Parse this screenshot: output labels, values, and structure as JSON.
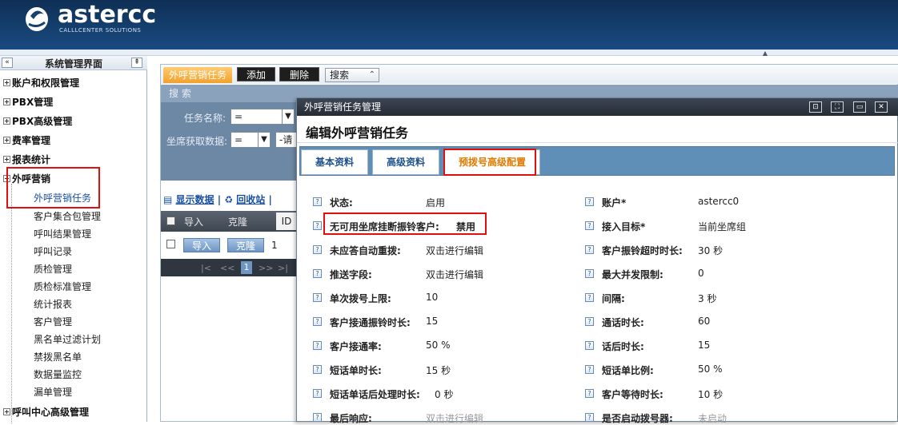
{
  "header": {
    "logo_text": "astercc",
    "logo_subtitle": "CALLLCENTER SOLUTIONS",
    "brand_color": "#15406f"
  },
  "sidebar": {
    "title": "系统管理界面",
    "collapse_icon": "«",
    "pin_icon": "⇞",
    "groups": [
      {
        "label": "账户和权限管理"
      },
      {
        "label": "PBX管理"
      },
      {
        "label": "PBX高级管理"
      },
      {
        "label": "费率管理"
      },
      {
        "label": "报表统计"
      },
      {
        "label": "外呼营销"
      }
    ],
    "outbound_items": [
      "外呼营销任务",
      "客户集合包管理",
      "呼叫结果管理",
      "呼叫记录",
      "质检管理",
      "质检标准管理",
      "统计报表",
      "客户管理",
      "黑名单过滤计划",
      "禁拨黑名单",
      "数据量监控",
      "漏单管理"
    ],
    "last_group": "呼叫中心高级管理"
  },
  "main": {
    "tab": "外呼营销任务",
    "add_button": "添加",
    "delete_button": "删除",
    "search_toggle": "搜索",
    "search_toggle_icon": "⌃",
    "search_header": "搜 索",
    "task_name_label": "任务名称:",
    "task_name_op": "=",
    "agent_data_label": "坐席获取数据:",
    "agent_data_op": "=",
    "agent_data_value": "-请",
    "link_show": "显示数据",
    "link_sep": "|",
    "link_recycle": "回收站",
    "grid_cols": [
      "导入",
      "克隆",
      "ID"
    ],
    "row_import": "导入",
    "row_clone": "克隆",
    "row_id": "1",
    "pager": [
      "|<",
      "<<",
      "1",
      ">>",
      ">|"
    ]
  },
  "dialog": {
    "title": "外呼营销任务管理",
    "heading": "编辑外呼营销任务",
    "tabs": [
      "基本资料",
      "高级资料",
      "预拨号高级配置"
    ],
    "icons": [
      "restore-icon",
      "maximize-icon",
      "minimize-icon",
      "close-icon"
    ],
    "left_fields": [
      {
        "label": "状态:",
        "value": "启用"
      },
      {
        "label": "无可用坐席挂断振铃客户:",
        "value": "禁用"
      },
      {
        "label": "未应答自动重拨:",
        "value": "双击进行编辑"
      },
      {
        "label": "推送字段:",
        "value": "双击进行编辑"
      },
      {
        "label": "单次拨号上限:",
        "value": "10"
      },
      {
        "label": "客户接通振铃时长:",
        "value": "15"
      },
      {
        "label": "客户接通率:",
        "value": "50 %"
      },
      {
        "label": "短话单时长:",
        "value": "15 秒"
      },
      {
        "label": "短话单话后处理时长:",
        "value": "0 秒"
      },
      {
        "label": "最后响应:",
        "value": "双击进行编辑"
      }
    ],
    "right_fields": [
      {
        "label": "账户*",
        "value": "astercc0"
      },
      {
        "label": "接入目标*",
        "value": "当前坐席组"
      },
      {
        "label": "客户振铃超时时长:",
        "value": "30 秒"
      },
      {
        "label": "最大并发限制:",
        "value": "0"
      },
      {
        "label": "间隔:",
        "value": "3 秒"
      },
      {
        "label": "通话时长:",
        "value": "60"
      },
      {
        "label": "话后时长:",
        "value": "15"
      },
      {
        "label": "短话单比例:",
        "value": "50 %"
      },
      {
        "label": "客户等待时长:",
        "value": "10 秒"
      },
      {
        "label": "是否启动拨号器:",
        "value": "未启动"
      }
    ],
    "active_tab_color": "#e07b00",
    "highlight_color": "#e01010"
  }
}
